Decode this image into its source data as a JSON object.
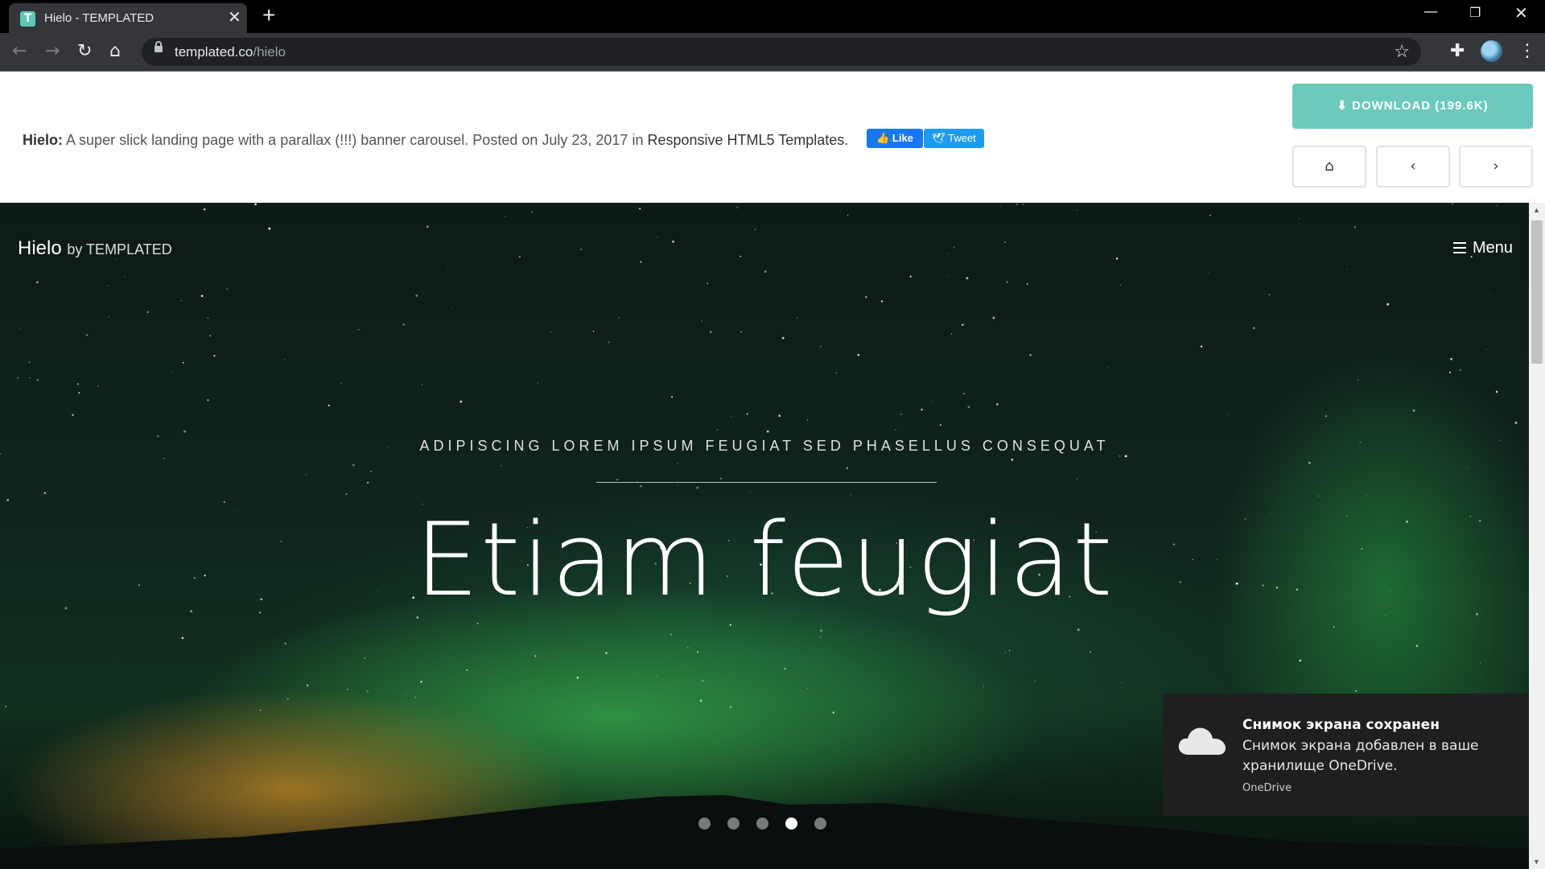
{
  "browser": {
    "tab_title": "Hielo - TEMPLATED",
    "favicon_letter": "T",
    "url_host": "templated.co",
    "url_path": "/hielo",
    "window_controls": [
      "minimize-icon",
      "restore-icon",
      "close-icon"
    ]
  },
  "infobar": {
    "name": "Hielo:",
    "description": "A super slick landing page with a parallax (!!!) banner carousel. Posted on July 23, 2017 in",
    "category": "Responsive HTML5 Templates.",
    "like_label": "Like",
    "tweet_label": "Tweet",
    "download_label": "DOWNLOAD (199.6K)",
    "nav_icons": [
      "home-icon",
      "chevron-left-icon",
      "chevron-right-icon"
    ],
    "accent_color": "#6cc9bd"
  },
  "hero": {
    "logo_name": "Hielo",
    "logo_by": "by TEMPLATED",
    "menu_label": "Menu",
    "subtitle": "ADIPISCING LOREM IPSUM FEUGIAT SED PHASELLUS CONSEQUAT",
    "headline": "Etiam feugiat",
    "slide_count": 5,
    "active_slide": 4
  },
  "toast": {
    "title": "Снимок экрана сохранен",
    "body": "Снимок экрана добавлен в ваше хранилище OneDrive.",
    "source": "OneDrive"
  }
}
